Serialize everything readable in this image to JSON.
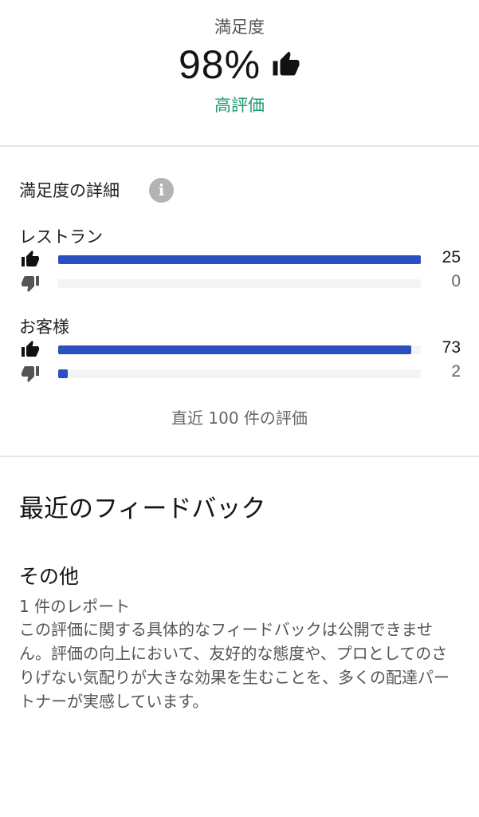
{
  "summary": {
    "label": "満足度",
    "value": "98%",
    "sublabel": "高評価",
    "icon": "thumbs-up-icon",
    "sublabel_color": "#1f9a73"
  },
  "details": {
    "title": "満足度の詳細",
    "info_icon": "info-icon",
    "groups": [
      {
        "label": "レストラン",
        "likes": "25",
        "dislikes": "0",
        "like_fraction": 1.0,
        "dislike_fraction": 0.0
      },
      {
        "label": "お客様",
        "likes": "73",
        "dislikes": "2",
        "like_fraction": 0.973,
        "dislike_fraction": 0.027
      }
    ],
    "bar_color": "#2b4fbf",
    "footnote": "直近 100 件の評価"
  },
  "feedback": {
    "heading": "最近のフィードバック",
    "category": "その他",
    "report_count": "1 件のレポート",
    "body": "この評価に関する具体的なフィードバックは公開できません。評価の向上において、友好的な態度や、プロとしてのさりげない気配りが大きな効果を生むことを、多くの配達パートナーが実感しています。"
  }
}
